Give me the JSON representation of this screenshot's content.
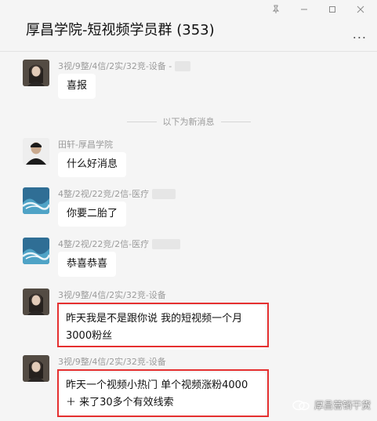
{
  "window": {
    "title": "厚昌学院-短视频学员群 (353)",
    "controls": [
      "pin",
      "minimize",
      "maximize",
      "close"
    ],
    "more_label": "..."
  },
  "divider_text": "以下为新消息",
  "messages": [
    {
      "sender": "3视/9整/4信/2实/32竞-设备 -",
      "text": "喜报",
      "avatar": "woman-portrait"
    },
    {
      "sender": "田轩-厚昌学院",
      "text": "什么好消息",
      "avatar": "man-portrait"
    },
    {
      "sender": "4整/2视/22竞/2信-医疗",
      "text": "你要二胎了",
      "avatar": "ocean-wave"
    },
    {
      "sender": "4整/2视/22竞/2信-医疗",
      "text": "恭喜恭喜",
      "avatar": "ocean-wave"
    },
    {
      "sender": "3视/9整/4信/2实/32竞-设备",
      "text": "昨天我是不是跟你说 我的短视频一个月3000粉丝",
      "avatar": "woman-portrait",
      "highlighted": true
    },
    {
      "sender": "3视/9整/4信/2实/32竞-设备",
      "text": "昨天一个视频小热门  单个视频涨粉4000＋ 来了30多个有效线索",
      "avatar": "woman-portrait",
      "highlighted": true
    }
  ],
  "watermark": "厚昌营销干货",
  "colors": {
    "highlight_border": "#e53030",
    "background": "#f5f5f5",
    "bubble": "#ffffff"
  }
}
